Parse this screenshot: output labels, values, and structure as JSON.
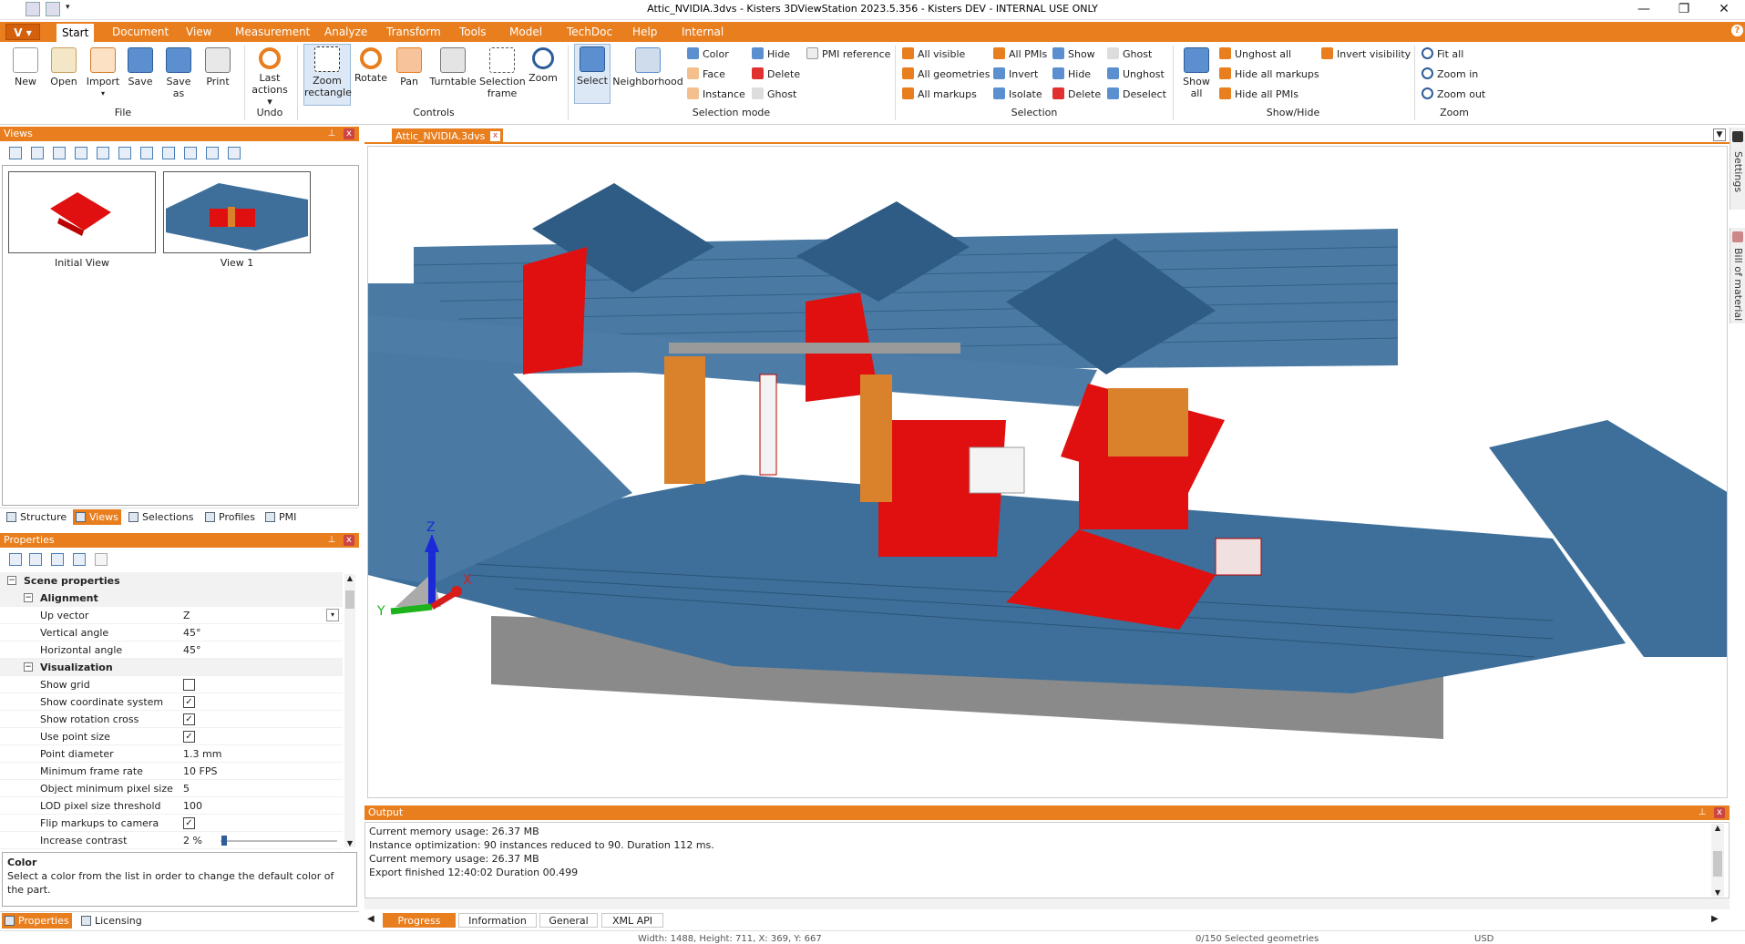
{
  "window": {
    "title": "Attic_NVIDIA.3dvs - Kisters 3DViewStation 2023.5.356 - Kisters DEV - INTERNAL USE ONLY",
    "minimize": "—",
    "restore": "❐",
    "close": "✕"
  },
  "app_menu": {
    "label": "V ▾"
  },
  "tabs": [
    "Start",
    "Document",
    "View",
    "Measurement",
    "Analyze",
    "Transform",
    "Tools",
    "Model",
    "TechDoc",
    "Help",
    "Internal"
  ],
  "ribbon": {
    "file": {
      "group": "File",
      "new": "New",
      "open": "Open",
      "import": "Import",
      "save": "Save",
      "save_as": "Save as",
      "print": "Print"
    },
    "undo": {
      "group": "Undo",
      "last_actions": "Last actions ▾"
    },
    "controls": {
      "group": "Controls",
      "zoom_rect": "Zoom rectangle",
      "rotate": "Rotate",
      "pan": "Pan",
      "turntable": "Turntable",
      "selection_frame": "Selection frame",
      "zoom": "Zoom"
    },
    "selection_mode": {
      "group": "Selection mode",
      "select": "Select",
      "neighborhood": "Neighborhood",
      "color": "Color",
      "face": "Face",
      "instance": "Instance",
      "hide": "Hide",
      "delete": "Delete",
      "ghost": "Ghost",
      "pmi_ref": "PMI reference"
    },
    "selection": {
      "group": "Selection",
      "all_visible": "All visible",
      "all_geometries": "All geometries",
      "all_markups": "All markups",
      "all_pmis": "All PMIs",
      "invert": "Invert",
      "isolate": "Isolate",
      "show": "Show",
      "hide": "Hide",
      "delete": "Delete",
      "ghost": "Ghost",
      "unghost": "Unghost",
      "deselect": "Deselect"
    },
    "showhide": {
      "group": "Show/Hide",
      "show_all": "Show all",
      "unghost_all": "Unghost all",
      "hide_all_markups": "Hide all markups",
      "hide_all_pmis": "Hide all PMIs",
      "invert_visibility": "Invert visibility"
    },
    "zoom": {
      "group": "Zoom",
      "fit_all": "Fit all",
      "zoom_in": "Zoom in",
      "zoom_out": "Zoom out"
    }
  },
  "views_panel": {
    "title": "Views",
    "pin": "📌",
    "close": "x",
    "thumbs": [
      {
        "label": "Initial View"
      },
      {
        "label": "View 1"
      }
    ]
  },
  "left_tabs": [
    "Structure",
    "Views",
    "Selections",
    "Profiles",
    "PMI"
  ],
  "properties": {
    "title": "Properties",
    "pin": "📌",
    "close": "x",
    "scene": "Scene properties",
    "alignment": "Alignment",
    "rows_align": [
      {
        "label": "Up vector",
        "value": "Z"
      },
      {
        "label": "Vertical angle",
        "value": "45°"
      },
      {
        "label": "Horizontal angle",
        "value": "45°"
      }
    ],
    "visualization": "Visualization",
    "rows_vis": [
      {
        "label": "Show grid",
        "check": false
      },
      {
        "label": "Show coordinate system",
        "check": true
      },
      {
        "label": "Show rotation cross",
        "check": true
      },
      {
        "label": "Use point size",
        "check": true
      },
      {
        "label": "Point diameter",
        "value": "1.3 mm"
      },
      {
        "label": "Minimum frame rate",
        "value": "10 FPS"
      },
      {
        "label": "Object minimum pixel size",
        "value": "5"
      },
      {
        "label": "LOD pixel size threshold",
        "value": "100"
      },
      {
        "label": "Flip markups to camera",
        "check": true
      },
      {
        "label": "Increase contrast",
        "value": "2 %"
      }
    ],
    "help_title": "Color",
    "help_text": "Select a color from the list in order to change the default color of the part."
  },
  "bottom_left_tabs": [
    "Properties",
    "Licensing"
  ],
  "doc_tab": {
    "label": "Attic_NVIDIA.3dvs",
    "close": "x"
  },
  "output": {
    "title": "Output",
    "pin": "📌",
    "close": "x",
    "lines": [
      "Current memory usage: 26.37 MB",
      "Instance optimization: 90 instances reduced to 90. Duration 112 ms.",
      "Current memory usage: 26.37 MB",
      "Export finished 12:40:02 Duration 00.499"
    ]
  },
  "output_tabs": [
    "Progress",
    "Information",
    "General",
    "XML API"
  ],
  "status": {
    "coords": "Width: 1488, Height: 711, X: 369, Y: 667",
    "selected": "0/150 Selected geometries",
    "unit": "USD"
  },
  "right_sidebar": [
    "Settings",
    "Bill of material"
  ],
  "axes": {
    "x": "X",
    "y": "Y",
    "z": "Z"
  },
  "colors": {
    "accent": "#e87e1e",
    "model_blue": "#3d6f9a",
    "model_red": "#e01010",
    "wood": "#d9822b"
  }
}
